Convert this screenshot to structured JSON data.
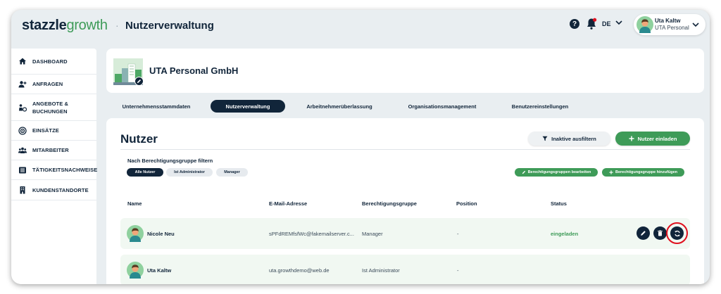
{
  "brand": {
    "bold": "stazzle",
    "light": "growth"
  },
  "header": {
    "separator": "·",
    "title": "Nutzerverwaltung",
    "help_label": "?",
    "language": "DE",
    "user": {
      "name": "Uta Kaltw",
      "company": "UTA Personal"
    }
  },
  "sidebar": {
    "items": [
      {
        "label": "DASHBOARD",
        "icon": "home-icon"
      },
      {
        "label": "ANFRAGEN",
        "icon": "add-user-icon"
      },
      {
        "label": "ANGEBOTE & BUCHUNGEN",
        "icon": "offers-icon"
      },
      {
        "label": "EINSÄTZE",
        "icon": "target-icon"
      },
      {
        "label": "MITARBEITER",
        "icon": "team-icon"
      },
      {
        "label": "TÄTIGKEITSNACHWEISE",
        "icon": "list-icon"
      },
      {
        "label": "KUNDENSTANDORTE",
        "icon": "building-icon"
      }
    ]
  },
  "company": {
    "name": "UTA Personal GmbH"
  },
  "tabs": [
    {
      "label": "Unternehmensstammdaten",
      "active": false
    },
    {
      "label": "Nutzerverwaltung",
      "active": true
    },
    {
      "label": "Arbeitnehmerüberlassung",
      "active": false
    },
    {
      "label": "Organisationsmanagement",
      "active": false
    },
    {
      "label": "Benutzereinstellungen",
      "active": false
    }
  ],
  "main": {
    "title": "Nutzer",
    "filter_inactive_label": "Inaktive ausfiltern",
    "invite_label": "Nutzer einladen",
    "group_filter_title": "Nach Berechtigungsgruppe filtern",
    "chips": [
      {
        "label": "Alle Nutzer",
        "active": true
      },
      {
        "label": "Ist Administrator",
        "active": false
      },
      {
        "label": "Manager",
        "active": false
      }
    ],
    "edit_groups_label": "Berechtigungsgruppen bearbeiten",
    "add_group_label": "Berechtigungsgruppe hinzufügen",
    "columns": [
      "Name",
      "E-Mail-Adresse",
      "Berechtigungsgruppe",
      "Position",
      "Status"
    ],
    "rows": [
      {
        "name": "Nicole Neu",
        "email": "sPFdREMfsfWc@fakemailserver.c...",
        "group": "Manager",
        "position": "-",
        "status": "eingeladen",
        "actions": true
      },
      {
        "name": "Uta Kaltw",
        "email": "uta.growthdemo@web.de",
        "group": "Ist Administrator",
        "position": "-",
        "status": "",
        "actions": false
      }
    ]
  },
  "colors": {
    "navy": "#11253a",
    "green": "#3e9b58",
    "highlight": "#e0101e",
    "background": "#e9eef1"
  }
}
